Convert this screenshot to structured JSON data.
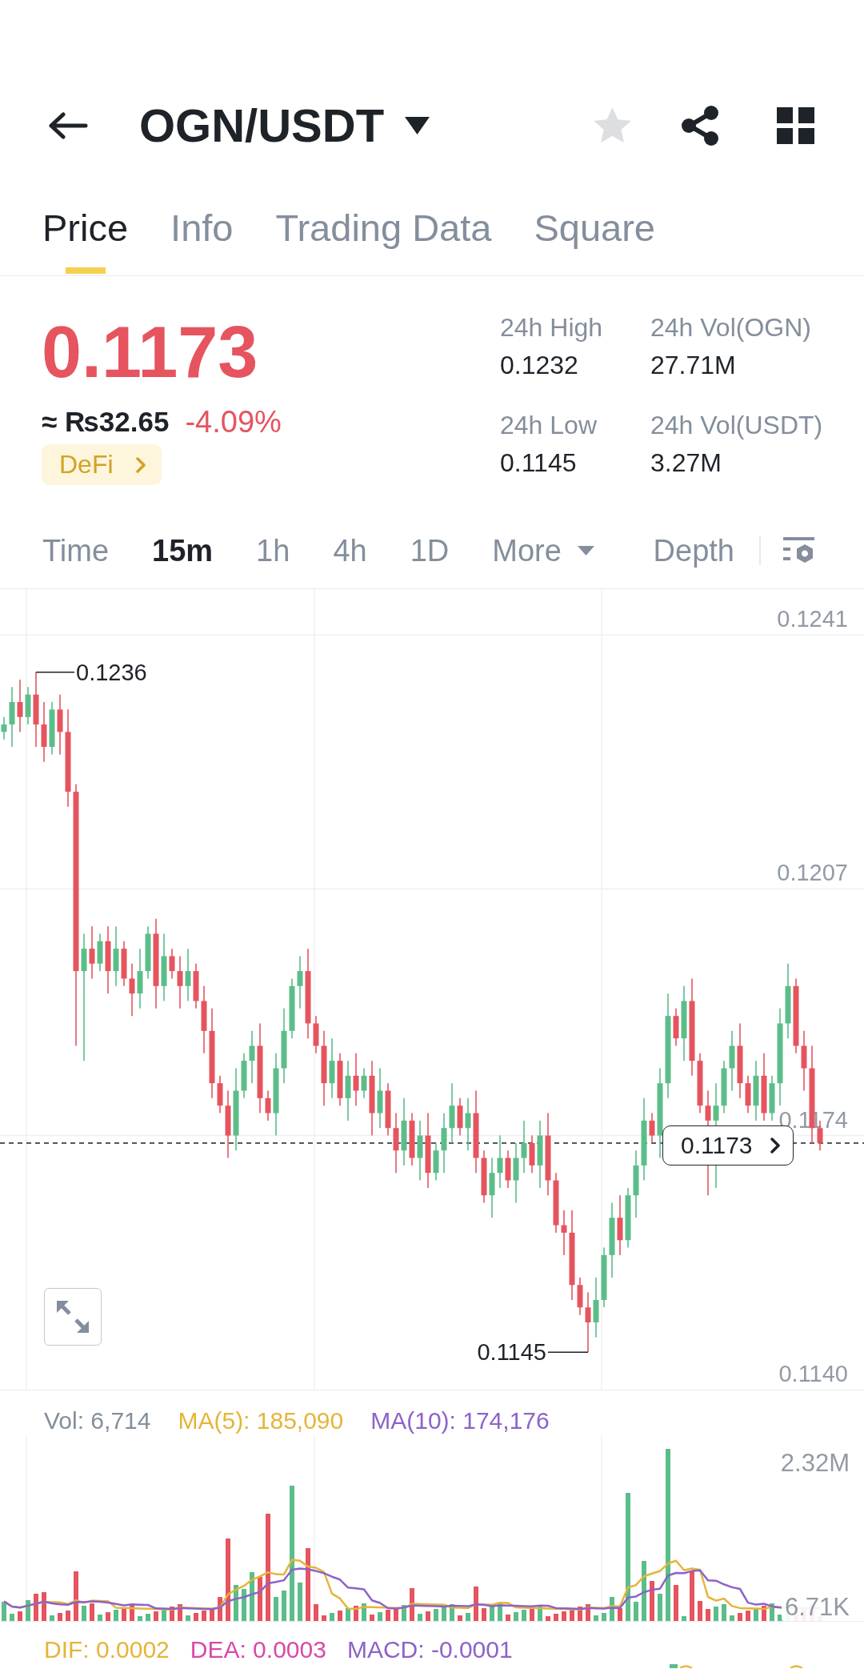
{
  "header": {
    "title": "OGN/USDT",
    "favorite": false
  },
  "tabs": [
    {
      "label": "Price",
      "selected": true
    },
    {
      "label": "Info",
      "selected": false
    },
    {
      "label": "Trading Data",
      "selected": false
    },
    {
      "label": "Square",
      "selected": false
    }
  ],
  "ticker": {
    "last_price": "0.1173",
    "fiat_value": "≈ ₨32.65",
    "change": "-4.09%",
    "tag": "DeFi"
  },
  "stats": [
    {
      "label": "24h High",
      "value": "0.1232"
    },
    {
      "label": "24h Vol(OGN)",
      "value": "27.71M"
    },
    {
      "label": "24h Low",
      "value": "0.1145"
    },
    {
      "label": "24h Vol(USDT)",
      "value": "3.27M"
    }
  ],
  "intervals": [
    {
      "label": "Time",
      "kind": "interval",
      "selected": false
    },
    {
      "label": "15m",
      "kind": "interval",
      "selected": true
    },
    {
      "label": "1h",
      "kind": "interval",
      "selected": false
    },
    {
      "label": "4h",
      "kind": "interval",
      "selected": false
    },
    {
      "label": "1D",
      "kind": "interval",
      "selected": false
    },
    {
      "label": "More",
      "kind": "menu",
      "selected": false
    },
    {
      "label": "Depth",
      "kind": "view",
      "selected": false
    }
  ],
  "price_chart": {
    "chart_data": {
      "type": "candlestick",
      "ohlc": [
        [
          0.1228,
          0.123,
          0.1227,
          0.1229
        ],
        [
          0.1229,
          0.1234,
          0.1226,
          0.1232
        ],
        [
          0.1232,
          0.1235,
          0.1228,
          0.123
        ],
        [
          0.123,
          0.1234,
          0.1229,
          0.1233
        ],
        [
          0.1233,
          0.1236,
          0.1226,
          0.1229
        ],
        [
          0.1229,
          0.1232,
          0.1224,
          0.1226
        ],
        [
          0.1226,
          0.1232,
          0.1225,
          0.1231
        ],
        [
          0.1231,
          0.1233,
          0.1225,
          0.1228
        ],
        [
          0.1228,
          0.1231,
          0.1218,
          0.122
        ],
        [
          0.122,
          0.1221,
          0.1186,
          0.1196
        ],
        [
          0.1196,
          0.1201,
          0.1184,
          0.1199
        ],
        [
          0.1199,
          0.1202,
          0.1195,
          0.1197
        ],
        [
          0.1197,
          0.1201,
          0.1196,
          0.12
        ],
        [
          0.12,
          0.1202,
          0.1193,
          0.1196
        ],
        [
          0.1196,
          0.1202,
          0.1194,
          0.1199
        ],
        [
          0.1199,
          0.12,
          0.1194,
          0.1195
        ],
        [
          0.1195,
          0.1197,
          0.119,
          0.1193
        ],
        [
          0.1193,
          0.1199,
          0.1191,
          0.1196
        ],
        [
          0.1196,
          0.1202,
          0.1195,
          0.1201
        ],
        [
          0.1201,
          0.1203,
          0.1191,
          0.1194
        ],
        [
          0.1194,
          0.1201,
          0.1192,
          0.1198
        ],
        [
          0.1198,
          0.1199,
          0.1195,
          0.1196
        ],
        [
          0.1196,
          0.1198,
          0.1191,
          0.1194
        ],
        [
          0.1194,
          0.1199,
          0.1192,
          0.1196
        ],
        [
          0.1196,
          0.1197,
          0.1191,
          0.1192
        ],
        [
          0.1192,
          0.1194,
          0.1185,
          0.1188
        ],
        [
          0.1188,
          0.1191,
          0.1179,
          0.1181
        ],
        [
          0.1181,
          0.1182,
          0.1177,
          0.1178
        ],
        [
          0.1178,
          0.118,
          0.1171,
          0.1174
        ],
        [
          0.1174,
          0.1183,
          0.1172,
          0.118
        ],
        [
          0.118,
          0.1185,
          0.1179,
          0.1184
        ],
        [
          0.1184,
          0.1188,
          0.1181,
          0.1186
        ],
        [
          0.1186,
          0.1189,
          0.1177,
          0.1179
        ],
        [
          0.1179,
          0.118,
          0.1176,
          0.1177
        ],
        [
          0.1177,
          0.1185,
          0.1174,
          0.1183
        ],
        [
          0.1183,
          0.1191,
          0.1181,
          0.1188
        ],
        [
          0.1188,
          0.1195,
          0.1187,
          0.1194
        ],
        [
          0.1194,
          0.1198,
          0.1191,
          0.1196
        ],
        [
          0.1196,
          0.1199,
          0.1187,
          0.1189
        ],
        [
          0.1189,
          0.119,
          0.1185,
          0.1186
        ],
        [
          0.1186,
          0.1188,
          0.1178,
          0.1181
        ],
        [
          0.1181,
          0.1187,
          0.1179,
          0.1184
        ],
        [
          0.1184,
          0.1185,
          0.1178,
          0.1179
        ],
        [
          0.1179,
          0.1184,
          0.1176,
          0.1182
        ],
        [
          0.1182,
          0.1185,
          0.1178,
          0.118
        ],
        [
          0.118,
          0.1183,
          0.1179,
          0.1182
        ],
        [
          0.1182,
          0.1184,
          0.1174,
          0.1177
        ],
        [
          0.1177,
          0.1183,
          0.1175,
          0.118
        ],
        [
          0.118,
          0.1181,
          0.1174,
          0.1175
        ],
        [
          0.1175,
          0.1177,
          0.1169,
          0.1172
        ],
        [
          0.1172,
          0.1179,
          0.117,
          0.1176
        ],
        [
          0.1176,
          0.1177,
          0.117,
          0.1171
        ],
        [
          0.1171,
          0.1176,
          0.1168,
          0.1174
        ],
        [
          0.1174,
          0.1177,
          0.1167,
          0.1169
        ],
        [
          0.1169,
          0.1173,
          0.1168,
          0.1172
        ],
        [
          0.1172,
          0.1177,
          0.1169,
          0.1175
        ],
        [
          0.1175,
          0.1181,
          0.1173,
          0.1178
        ],
        [
          0.1178,
          0.1179,
          0.1174,
          0.1175
        ],
        [
          0.1175,
          0.1179,
          0.1172,
          0.1177
        ],
        [
          0.1177,
          0.118,
          0.1169,
          0.1171
        ],
        [
          0.1171,
          0.1172,
          0.1165,
          0.1166
        ],
        [
          0.1166,
          0.1171,
          0.1163,
          0.1169
        ],
        [
          0.1169,
          0.1174,
          0.1167,
          0.1171
        ],
        [
          0.1171,
          0.1172,
          0.1167,
          0.1168
        ],
        [
          0.1168,
          0.1173,
          0.1165,
          0.1171
        ],
        [
          0.1171,
          0.1176,
          0.1169,
          0.1173
        ],
        [
          0.1173,
          0.1174,
          0.1169,
          0.117
        ],
        [
          0.117,
          0.1176,
          0.1167,
          0.1174
        ],
        [
          0.1174,
          0.1177,
          0.1166,
          0.1168
        ],
        [
          0.1168,
          0.1169,
          0.1161,
          0.1162
        ],
        [
          0.1162,
          0.1164,
          0.1158,
          0.1161
        ],
        [
          0.1161,
          0.1164,
          0.1152,
          0.1154
        ],
        [
          0.1154,
          0.1155,
          0.115,
          0.1151
        ],
        [
          0.1151,
          0.1153,
          0.1145,
          0.1149
        ],
        [
          0.1149,
          0.1155,
          0.1147,
          0.1152
        ],
        [
          0.1152,
          0.1159,
          0.1151,
          0.1158
        ],
        [
          0.1158,
          0.1165,
          0.1155,
          0.1163
        ],
        [
          0.1163,
          0.1166,
          0.1158,
          0.116
        ],
        [
          0.116,
          0.1167,
          0.1159,
          0.1166
        ],
        [
          0.1166,
          0.1172,
          0.1163,
          0.117
        ],
        [
          0.117,
          0.1179,
          0.1168,
          0.1176
        ],
        [
          0.1176,
          0.1177,
          0.1173,
          0.1174
        ],
        [
          0.1174,
          0.1183,
          0.1171,
          0.1181
        ],
        [
          0.1181,
          0.1193,
          0.1179,
          0.119
        ],
        [
          0.119,
          0.1191,
          0.1186,
          0.1187
        ],
        [
          0.1187,
          0.1194,
          0.1184,
          0.1192
        ],
        [
          0.1192,
          0.1195,
          0.1182,
          0.1184
        ],
        [
          0.1184,
          0.1185,
          0.1177,
          0.1178
        ],
        [
          0.1178,
          0.118,
          0.1166,
          0.1176
        ],
        [
          0.1176,
          0.1181,
          0.1167,
          0.1178
        ],
        [
          0.1178,
          0.1184,
          0.1177,
          0.1183
        ],
        [
          0.1183,
          0.1188,
          0.118,
          0.1186
        ],
        [
          0.1186,
          0.1189,
          0.1179,
          0.1181
        ],
        [
          0.1181,
          0.1182,
          0.1177,
          0.1178
        ],
        [
          0.1178,
          0.1184,
          0.1176,
          0.1182
        ],
        [
          0.1182,
          0.1185,
          0.1176,
          0.1177
        ],
        [
          0.1177,
          0.1182,
          0.1176,
          0.1181
        ],
        [
          0.1181,
          0.1191,
          0.1178,
          0.1189
        ],
        [
          0.1189,
          0.1197,
          0.1187,
          0.1194
        ],
        [
          0.1194,
          0.1195,
          0.1185,
          0.1186
        ],
        [
          0.1186,
          0.1188,
          0.118,
          0.1183
        ],
        [
          0.1183,
          0.1186,
          0.1173,
          0.1175
        ],
        [
          0.1175,
          0.1176,
          0.1172,
          0.1173
        ]
      ],
      "ylim": [
        0.114,
        0.1241
      ],
      "yticks": [
        {
          "value": 0.1241,
          "label": "0.1241"
        },
        {
          "value": 0.1207,
          "label": "0.1207"
        },
        {
          "value": 0.1174,
          "label": "0.1174"
        },
        {
          "value": 0.114,
          "label": "0.1140"
        }
      ],
      "annotations": [
        "0.1236",
        "0.1145"
      ],
      "ref_lines": [
        {
          "axis": "y",
          "value": 0.1173,
          "label": "0.1173"
        }
      ]
    }
  },
  "volume_chart": {
    "legend": [
      {
        "label": "Vol: 6,714",
        "color": "#848e9c"
      },
      {
        "label": "MA(5): 185,090",
        "color": "#e5b53b"
      },
      {
        "label": "MA(10): 174,176",
        "color": "#8c63c9"
      }
    ],
    "axis_labels": [
      "2.32M",
      "6.71K"
    ]
  },
  "macd": {
    "legend": [
      {
        "label": "DIF: 0.0002",
        "color": "#e5b53b"
      },
      {
        "label": "DEA: 0.0003",
        "color": "#d94aa6"
      },
      {
        "label": "MACD: -0.0001",
        "color": "#8c63c9"
      }
    ]
  }
}
